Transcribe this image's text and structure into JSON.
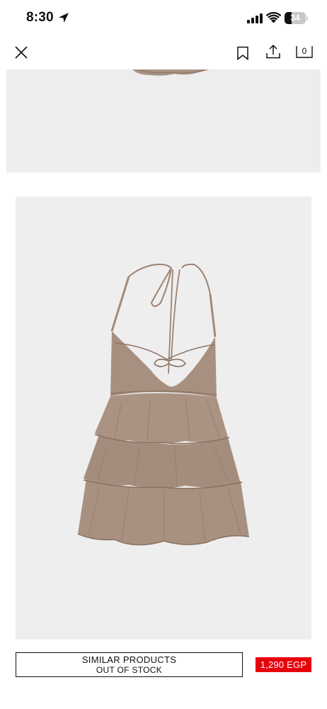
{
  "status_bar": {
    "time": "8:30",
    "battery_percent": "34",
    "battery_level": 0.34,
    "icons": [
      "location-arrow-icon",
      "signal-icon",
      "wifi-icon",
      "battery-icon"
    ]
  },
  "header": {
    "icons": [
      "close-icon",
      "bookmark-icon",
      "share-icon",
      "shopping-bag-icon"
    ],
    "bag_count": "0"
  },
  "gallery": {
    "images": [
      "dress-image-previous",
      "dress-image-main"
    ]
  },
  "footer": {
    "similar_label": "SIMILAR PRODUCTS",
    "stock_label": "OUT OF STOCK",
    "price": "1,290 EGP"
  },
  "colors": {
    "price_badge": "#e8000b",
    "image_background": "#efeeef",
    "dress": "#a89080"
  }
}
